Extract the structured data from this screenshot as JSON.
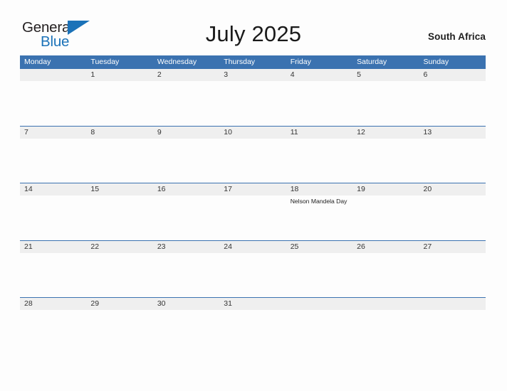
{
  "brand": {
    "name_part1": "General",
    "name_part2": "Blue",
    "color_dark": "#231f20",
    "color_blue": "#1b72b8"
  },
  "header": {
    "title": "July 2025",
    "country": "South Africa"
  },
  "theme": {
    "header_blue": "#3b72b0",
    "date_strip_gray": "#efefef",
    "page_background": "#fdfdfd",
    "text_dark": "#333333"
  },
  "calendar": {
    "weekdays": [
      "Monday",
      "Tuesday",
      "Wednesday",
      "Thursday",
      "Friday",
      "Saturday",
      "Sunday"
    ],
    "weeks": [
      {
        "days": [
          {
            "date": "",
            "event": ""
          },
          {
            "date": "1",
            "event": ""
          },
          {
            "date": "2",
            "event": ""
          },
          {
            "date": "3",
            "event": ""
          },
          {
            "date": "4",
            "event": ""
          },
          {
            "date": "5",
            "event": ""
          },
          {
            "date": "6",
            "event": ""
          }
        ]
      },
      {
        "days": [
          {
            "date": "7",
            "event": ""
          },
          {
            "date": "8",
            "event": ""
          },
          {
            "date": "9",
            "event": ""
          },
          {
            "date": "10",
            "event": ""
          },
          {
            "date": "11",
            "event": ""
          },
          {
            "date": "12",
            "event": ""
          },
          {
            "date": "13",
            "event": ""
          }
        ]
      },
      {
        "days": [
          {
            "date": "14",
            "event": ""
          },
          {
            "date": "15",
            "event": ""
          },
          {
            "date": "16",
            "event": ""
          },
          {
            "date": "17",
            "event": ""
          },
          {
            "date": "18",
            "event": "Nelson Mandela Day"
          },
          {
            "date": "19",
            "event": ""
          },
          {
            "date": "20",
            "event": ""
          }
        ]
      },
      {
        "days": [
          {
            "date": "21",
            "event": ""
          },
          {
            "date": "22",
            "event": ""
          },
          {
            "date": "23",
            "event": ""
          },
          {
            "date": "24",
            "event": ""
          },
          {
            "date": "25",
            "event": ""
          },
          {
            "date": "26",
            "event": ""
          },
          {
            "date": "27",
            "event": ""
          }
        ]
      },
      {
        "days": [
          {
            "date": "28",
            "event": ""
          },
          {
            "date": "29",
            "event": ""
          },
          {
            "date": "30",
            "event": ""
          },
          {
            "date": "31",
            "event": ""
          },
          {
            "date": "",
            "event": ""
          },
          {
            "date": "",
            "event": ""
          },
          {
            "date": "",
            "event": ""
          }
        ]
      }
    ]
  }
}
